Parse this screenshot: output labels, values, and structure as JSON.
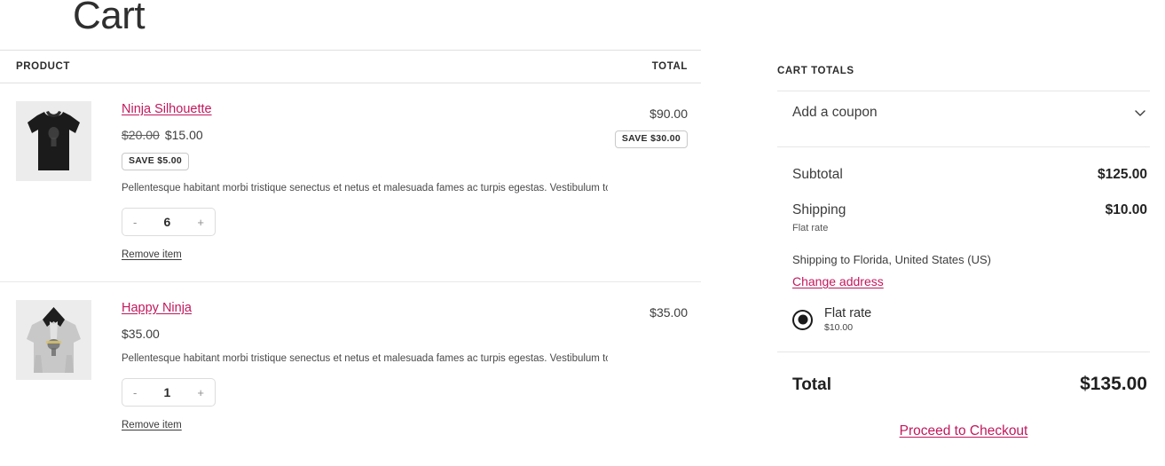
{
  "page": {
    "title": "Cart"
  },
  "table": {
    "columns": {
      "product": "PRODUCT",
      "total": "TOTAL"
    },
    "items": [
      {
        "name": "Ninja Silhouette",
        "thumb_icon": "black-tshirt-thumbnail",
        "price_old": "$20.00",
        "price_new": "$15.00",
        "save_badge": "SAVE $5.00",
        "description": "Pellentesque habitant morbi tristique senectus et netus et malesuada fames ac turpis egestas. Vestibulum tortor...",
        "qty": "6",
        "qty_decrease": "-",
        "qty_increase": "+",
        "remove_label": "Remove item",
        "line_total": "$90.00",
        "line_save_badge": "SAVE $30.00"
      },
      {
        "name": "Happy Ninja",
        "thumb_icon": "gray-hoodie-thumbnail",
        "price_old": "",
        "price_new": "$35.00",
        "save_badge": "",
        "description": "Pellentesque habitant morbi tristique senectus et netus et malesuada fames ac turpis egestas. Vestibulum tortor...",
        "qty": "1",
        "qty_decrease": "-",
        "qty_increase": "+",
        "remove_label": "Remove item",
        "line_total": "$35.00",
        "line_save_badge": ""
      }
    ]
  },
  "totals": {
    "heading": "CART TOTALS",
    "coupon_label": "Add a coupon",
    "subtotal_label": "Subtotal",
    "subtotal_value": "$125.00",
    "shipping_label": "Shipping",
    "shipping_value": "$10.00",
    "shipping_method_note": "Flat rate",
    "shipping_destination": "Shipping to Florida, United States (US)",
    "change_address_label": "Change address",
    "shipping_option_name": "Flat rate",
    "shipping_option_price": "$10.00",
    "total_label": "Total",
    "total_value": "$135.00",
    "checkout_label": "Proceed to Checkout"
  },
  "colors": {
    "link": "#c2185b",
    "text": "#2b2b2b",
    "border": "#e0e0e0",
    "thumb_bg": "#ececec"
  }
}
